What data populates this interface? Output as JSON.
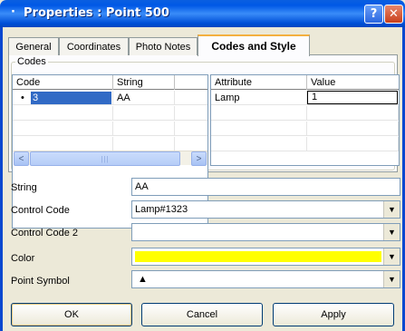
{
  "window": {
    "system_glyph": "·",
    "title": "Properties : Point 500",
    "help_glyph": "?",
    "close_glyph": "✕"
  },
  "tabs": [
    {
      "label": "General"
    },
    {
      "label": "Coordinates"
    },
    {
      "label": "Photo Notes"
    },
    {
      "label": "Codes and Style",
      "active": true
    }
  ],
  "codes_group": {
    "legend": "Codes",
    "code_grid": {
      "columns": [
        "Code",
        "String"
      ],
      "rows": [
        {
          "bullet": "•",
          "code": "3",
          "string": "AA",
          "selected": true
        }
      ]
    },
    "attribute_grid": {
      "columns": [
        "Attribute",
        "Value"
      ],
      "rows": [
        {
          "attribute": "Lamp",
          "value": "1"
        }
      ]
    },
    "scrollbar": {
      "left_glyph": "<",
      "right_glyph": ">",
      "grip_glyph": "|||"
    }
  },
  "properties": {
    "string": {
      "label": "String",
      "value": "AA"
    },
    "control_code": {
      "label": "Control Code",
      "value": "Lamp#1323"
    },
    "control_code_2": {
      "label": "Control Code 2",
      "value": ""
    },
    "color": {
      "label": "Color",
      "value_color": "#ffff00"
    },
    "point_symbol": {
      "label": "Point Symbol",
      "value": "▲"
    }
  },
  "dropdown_glyph": "▼",
  "buttons": {
    "ok": "OK",
    "cancel": "Cancel",
    "apply": "Apply"
  },
  "colors": {
    "title_bar": "#0058e6",
    "selection": "#316ac5",
    "window_bg": "#ece9d8"
  }
}
